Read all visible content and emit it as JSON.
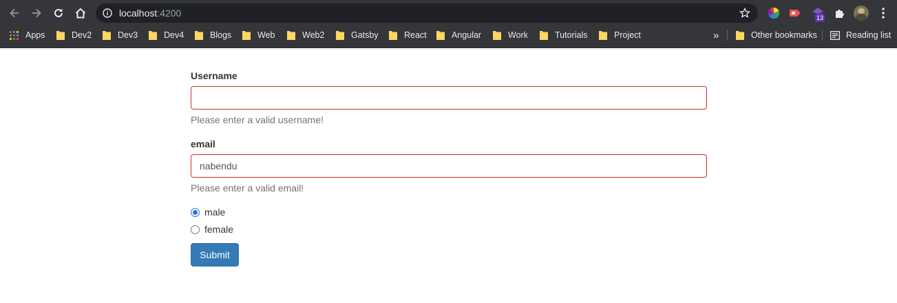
{
  "browser": {
    "address": {
      "host": "localhost",
      "port": ":4200"
    },
    "extensions": {
      "badge_count": "13"
    },
    "bookmarks": [
      {
        "label": "Apps"
      },
      {
        "label": "Dev2"
      },
      {
        "label": "Dev3"
      },
      {
        "label": "Dev4"
      },
      {
        "label": "Blogs"
      },
      {
        "label": "Web"
      },
      {
        "label": "Web2"
      },
      {
        "label": "Gatsby"
      },
      {
        "label": "React"
      },
      {
        "label": "Angular"
      },
      {
        "label": "Work"
      },
      {
        "label": "Tutorials"
      },
      {
        "label": "Project"
      }
    ],
    "overflow_label": "»",
    "other_bookmarks_label": "Other bookmarks",
    "reading_list_label": "Reading list"
  },
  "form": {
    "username": {
      "label": "Username",
      "value": "",
      "help": "Please enter a valid username!"
    },
    "email": {
      "label": "email",
      "value": "nabendu",
      "help": "Please enter a valid email!"
    },
    "gender": {
      "selected": "male",
      "options": [
        {
          "label": "male"
        },
        {
          "label": "female"
        }
      ]
    },
    "submit_label": "Submit"
  },
  "colors": {
    "chrome_bg": "#35363a",
    "omnibox_bg": "#202124",
    "invalid_border": "#c9302c",
    "primary_button": "#337ab7",
    "radio_accent": "#1a73e8"
  }
}
